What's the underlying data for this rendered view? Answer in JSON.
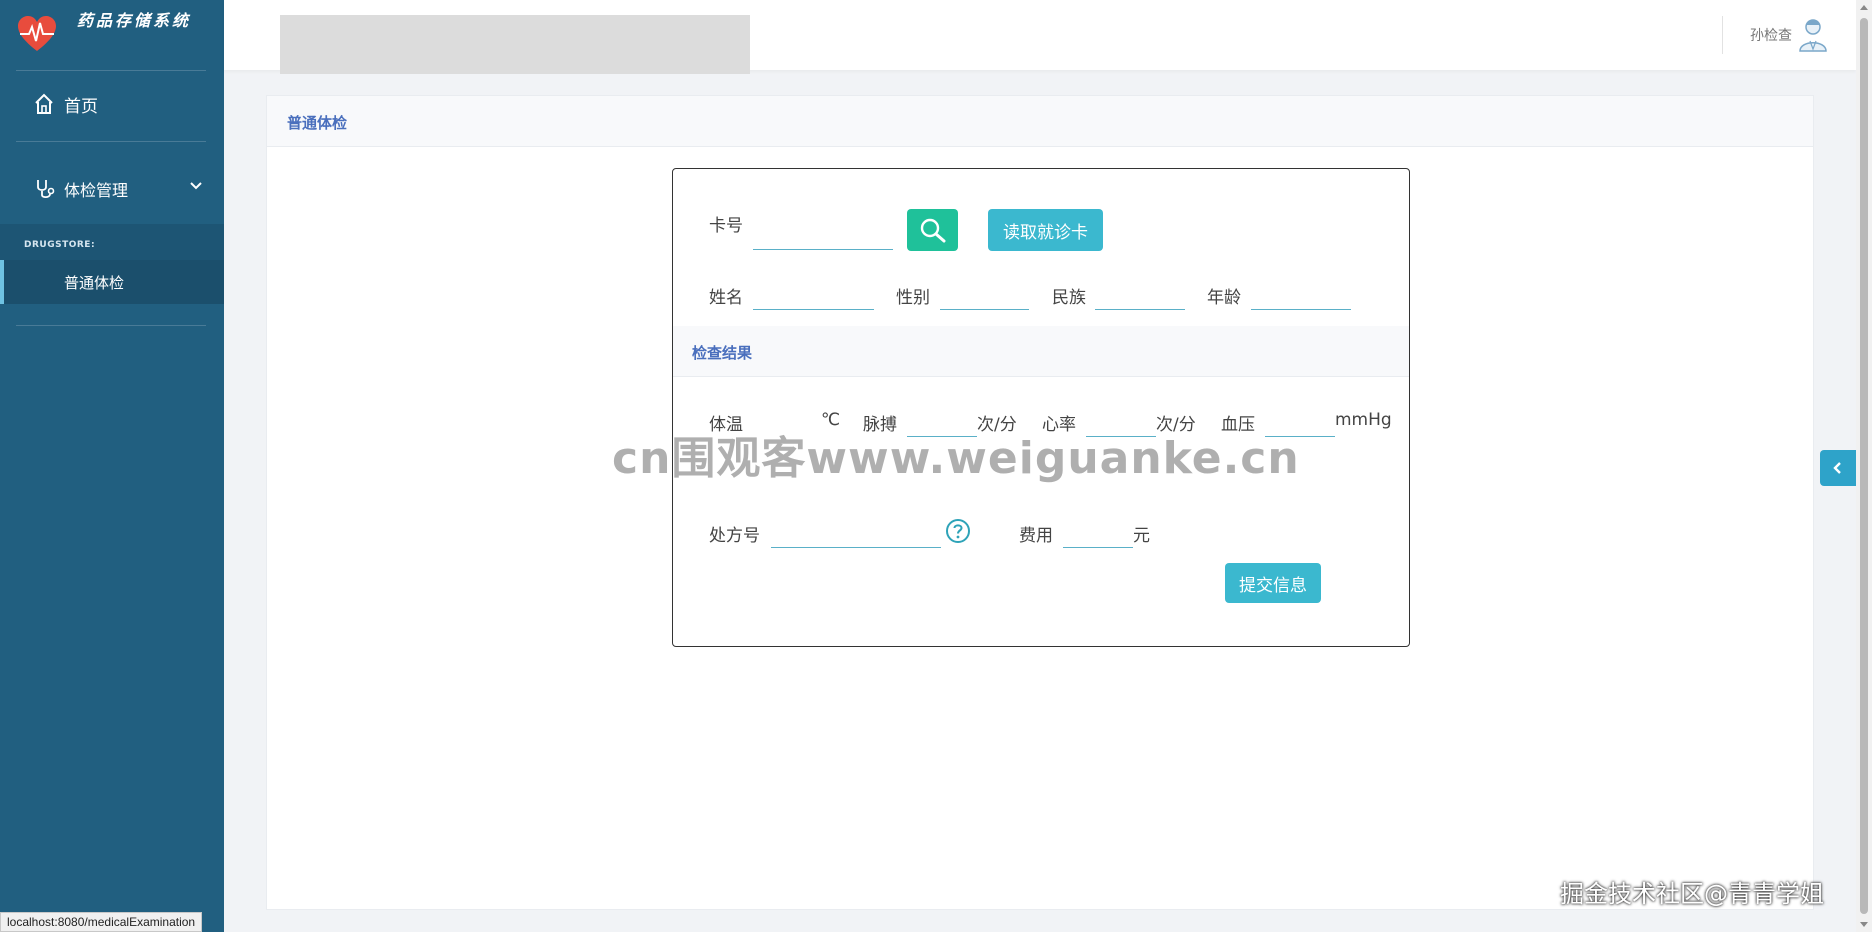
{
  "app": {
    "title": "药品存储系统",
    "accent_color": "#215f80"
  },
  "sidebar": {
    "home_label": "首页",
    "exam_menu_label": "体检管理",
    "section_label": "DRUGSTORE:",
    "active_item_label": "普通体检"
  },
  "header": {
    "user_name": "孙检查"
  },
  "page": {
    "title": "普通体检"
  },
  "form": {
    "card_label": "卡号",
    "card_value": "",
    "read_card_button": "读取就诊卡",
    "name_label": "姓名",
    "name_value": "",
    "gender_label": "性别",
    "gender_value": "",
    "ethnicity_label": "民族",
    "ethnicity_value": "",
    "age_label": "年龄",
    "age_value": "",
    "result_section_title": "检查结果",
    "temperature_label": "体温",
    "temperature_unit": "℃",
    "temperature_value": "",
    "pulse_label": "脉搏",
    "pulse_unit": "次/分",
    "pulse_value": "",
    "heart_rate_label": "心率",
    "heart_rate_unit": "次/分",
    "heart_rate_value": "",
    "blood_pressure_label": "血压",
    "blood_pressure_unit": "mmHg",
    "blood_pressure_value": "",
    "prescription_label": "处方号",
    "prescription_value": "",
    "fee_label": "费用",
    "fee_unit": "元",
    "fee_value": "",
    "submit_button": "提交信息"
  },
  "watermarks": {
    "center": "cn围观客www.weiguanke.cn",
    "corner": "掘金技术社区@青青学姐"
  },
  "status_bar": {
    "url": "localhost:8080/medicalExamination"
  },
  "icons": [
    "heart-logo-icon",
    "home-icon",
    "stethoscope-icon",
    "chevron-down-icon",
    "user-avatar-icon",
    "search-icon",
    "help-icon",
    "chevron-left-icon"
  ]
}
